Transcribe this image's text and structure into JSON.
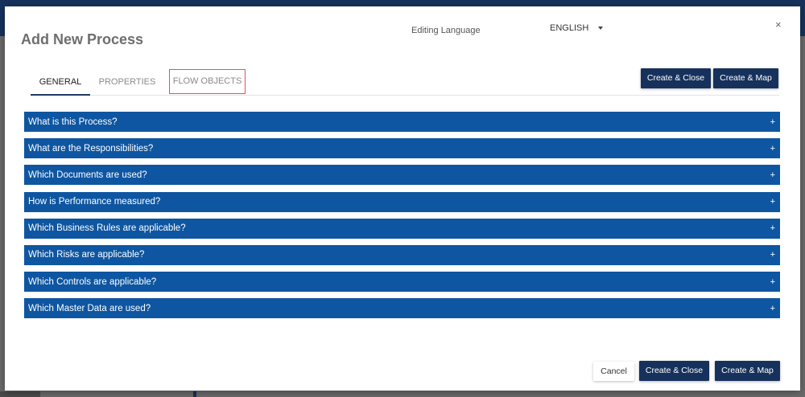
{
  "dialog": {
    "title": "Add New Process",
    "editing_language_label": "Editing Language",
    "language_value": "ENGLISH",
    "close_symbol": "×"
  },
  "tabs": [
    {
      "label": "GENERAL",
      "active": true
    },
    {
      "label": "PROPERTIES",
      "active": false
    },
    {
      "label": "FLOW OBJECTS",
      "active": false
    }
  ],
  "top_actions": {
    "create_close": "Create & Close",
    "create_map": "Create & Map"
  },
  "sections": [
    {
      "label": "What is this Process?"
    },
    {
      "label": "What are the Responsibilities?"
    },
    {
      "label": "Which Documents are used?"
    },
    {
      "label": "How is Performance measured?"
    },
    {
      "label": "Which Business Rules are applicable?"
    },
    {
      "label": "Which Risks are applicable?"
    },
    {
      "label": "Which Controls are applicable?"
    },
    {
      "label": "Which Master Data are used?"
    }
  ],
  "expand_symbol": "+",
  "footer_actions": {
    "cancel": "Cancel",
    "create_close": "Create & Close",
    "create_map": "Create & Map"
  },
  "colors": {
    "section_bar": "#0e56a1",
    "primary_button": "#16325c",
    "tab_highlight_border": "#e05555"
  }
}
